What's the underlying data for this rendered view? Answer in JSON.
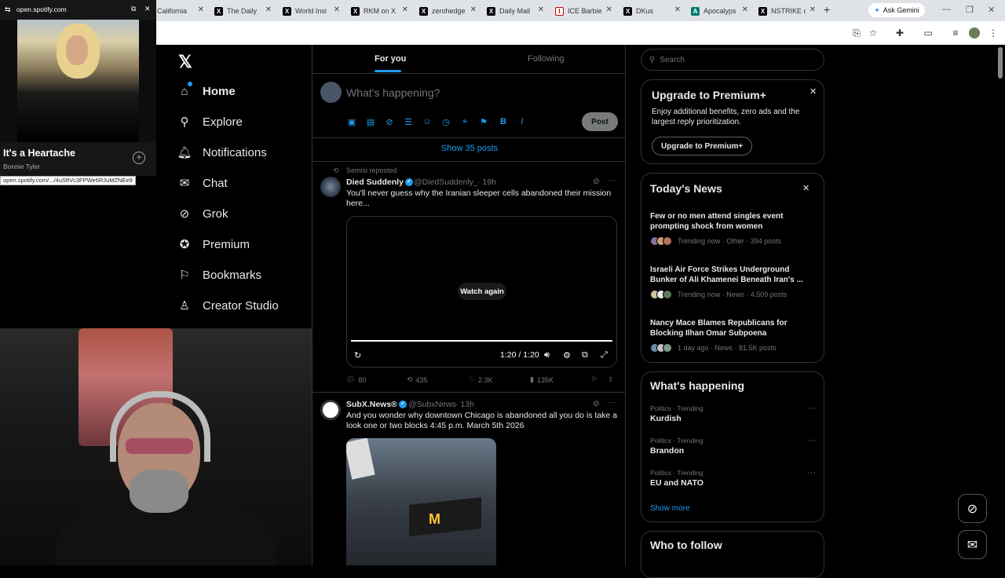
{
  "browser": {
    "tabs": [
      {
        "icon": "generic-favicon",
        "title": "California",
        "fav": ""
      },
      {
        "icon": "x-logo-icon",
        "title": "The Daily",
        "fav": "X"
      },
      {
        "icon": "x-logo-icon",
        "title": "World Insi",
        "fav": "X"
      },
      {
        "icon": "x-logo-icon",
        "title": "RKM on X",
        "fav": "X"
      },
      {
        "icon": "x-logo-icon",
        "title": "zerohedge",
        "fav": "X"
      },
      {
        "icon": "x-logo-icon",
        "title": "Daily Mail",
        "fav": "X"
      },
      {
        "icon": "ice-favicon",
        "title": "ICE Barbie",
        "fav": "I"
      },
      {
        "icon": "x-logo-icon",
        "title": "DKus",
        "fav": "X"
      },
      {
        "icon": "site-favicon",
        "title": "Apocalyps",
        "fav": "A"
      },
      {
        "icon": "x-logo-icon",
        "title": "NSTRIKE o",
        "fav": "X"
      }
    ],
    "new_tab": "+",
    "gemini_label": "Ask Gemini"
  },
  "spotify": {
    "url": "open.spotify.com",
    "song": "It's a Heartache",
    "artist": "Bonnie Tyler",
    "status_url": "open.spotify.com/.../4uSftVc3FPWe6RJuMZNEe9"
  },
  "nav": {
    "items": [
      {
        "label": "Home",
        "icon": "home-icon",
        "glyph": "⌂"
      },
      {
        "label": "Explore",
        "icon": "search-icon",
        "glyph": "⚲"
      },
      {
        "label": "Notifications",
        "icon": "bell-icon",
        "glyph": "🔔︎"
      },
      {
        "label": "Chat",
        "icon": "mail-icon",
        "glyph": "✉"
      },
      {
        "label": "Grok",
        "icon": "grok-icon",
        "glyph": "⊘"
      },
      {
        "label": "Premium",
        "icon": "premium-icon",
        "glyph": "✪"
      },
      {
        "label": "Bookmarks",
        "icon": "bookmark-icon",
        "glyph": "⚐"
      },
      {
        "label": "Creator Studio",
        "icon": "creator-icon",
        "glyph": "♙"
      }
    ]
  },
  "feed": {
    "tabs": [
      "For you",
      "Following"
    ],
    "compose_placeholder": "What's happening?",
    "post_label": "Post",
    "show_posts": "Show 35 posts",
    "tweets": [
      {
        "repost_line": "Semisi reposted",
        "name": "Died Suddenly",
        "handle": "@DiedSuddenly_",
        "time": "· 19h",
        "text": "You'll never guess why the Iranian sleeper cells abandoned their mission here...",
        "video": {
          "watch_again": "Watch again",
          "time": "1:20 / 1:20"
        },
        "stats": {
          "replies": "80",
          "reposts": "435",
          "likes": "2.3K",
          "views": "135K"
        }
      },
      {
        "name": "SubX.News®",
        "handle": "@SubxNews",
        "time": "· 13h",
        "text": "And you wonder why downtown Chicago is abandoned all you do is take a look one or two blocks 4:45 p.m. March 5th 2026",
        "photo_logo": "M"
      }
    ]
  },
  "sidebar": {
    "search_placeholder": "Search",
    "premium": {
      "title": "Upgrade to Premium+",
      "body": "Enjoy additional benefits, zero ads and the largest reply prioritization.",
      "button": "Upgrade to Premium+"
    },
    "news": {
      "title": "Today's News",
      "items": [
        {
          "headline": "Few or no men attend singles event prompting shock from women",
          "meta": "Trending now · Other · 394 posts"
        },
        {
          "headline": "Israeli Air Force Strikes Underground Bunker of Ali Khamenei Beneath Iran's ...",
          "meta": "Trending now · News · 4,509 posts"
        },
        {
          "headline": "Nancy Mace Blames Republicans for Blocking Ilhan Omar Subpoena",
          "meta": "1 day ago · News · 81.5K posts"
        }
      ]
    },
    "happening": {
      "title": "What's happening",
      "trends": [
        {
          "category": "Politics · Trending",
          "name": "Kurdish"
        },
        {
          "category": "Politics · Trending",
          "name": "Brandon"
        },
        {
          "category": "Politics · Trending",
          "name": "EU and NATO"
        }
      ],
      "show_more": "Show more"
    },
    "who_to_follow": "Who to follow"
  }
}
